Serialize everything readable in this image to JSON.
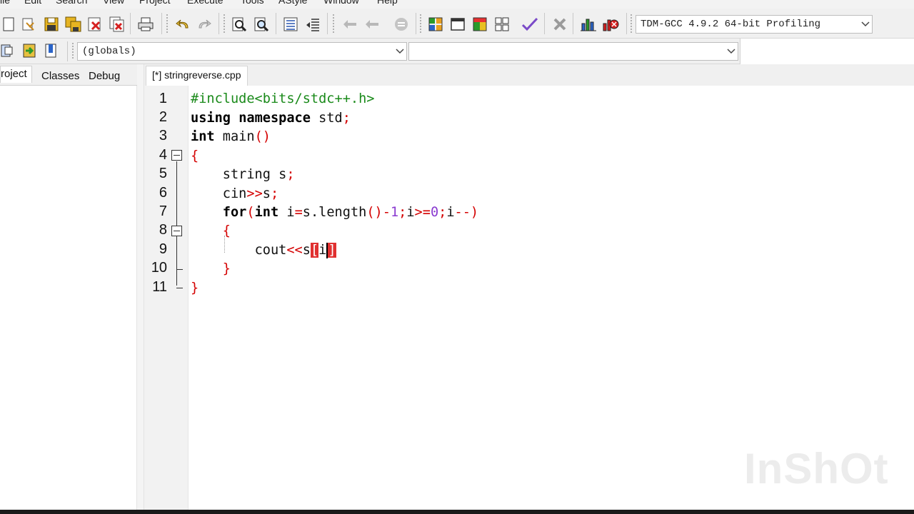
{
  "menu": {
    "items": [
      "ile",
      "Edit",
      "Search",
      "View",
      "Project",
      "Execute",
      "Tools",
      "AStyle",
      "Window",
      "Help"
    ]
  },
  "toolbar": {
    "icons": [
      "new-file-icon",
      "open-file-icon",
      "save-icon",
      "save-all-icon",
      "close-icon",
      "close-all-icon",
      "print-icon",
      "undo-icon",
      "redo-icon",
      "find-icon",
      "replace-icon",
      "indent-icon",
      "unindent-icon",
      "bookmark-back-icon",
      "bookmark-forward-icon",
      "goto-icon",
      "new-project-icon",
      "new-class-icon",
      "compile-run-icon",
      "grid-icon",
      "check-icon",
      "stop-icon",
      "chart-icon",
      "debug-icon"
    ],
    "compiler_select": "TDM-GCC 4.9.2 64-bit Profiling"
  },
  "toolbar2": {
    "icons": [
      "class-browse-icon",
      "goto-def-icon",
      "bookmark-icon"
    ],
    "scope_select": "(globals)",
    "symbol_select": ""
  },
  "left_panel": {
    "tabs": [
      "roject",
      "Classes",
      "Debug"
    ]
  },
  "editor": {
    "tab_label": "[*] stringreverse.cpp",
    "line_numbers": [
      "1",
      "2",
      "3",
      "4",
      "5",
      "6",
      "7",
      "8",
      "9",
      "10",
      "11"
    ]
  },
  "code": {
    "l1": "#include<bits/stdc++.h>",
    "l2_kw1": "using",
    "l2_kw2": "namespace",
    "l2_id": "std",
    "l3_kw": "int",
    "l3_id": "main",
    "l4": "{",
    "l5_kw": "string",
    "l5_id": "s",
    "l6_id": "cin",
    "l6_op": ">>",
    "l6_id2": "s",
    "l7_kw": "for",
    "l7_kw2": "int",
    "l7_a": "i",
    "l7_b": "s.length",
    "l7_num1": "1",
    "l7_c": "i",
    "l7_num2": "0",
    "l7_d": "i",
    "l8": "{",
    "l9_id": "cout",
    "l9_op": "<<",
    "l9_s": "s",
    "l9_idx": "i",
    "l10": "}",
    "l11": "}"
  },
  "watermark": "InShOt"
}
